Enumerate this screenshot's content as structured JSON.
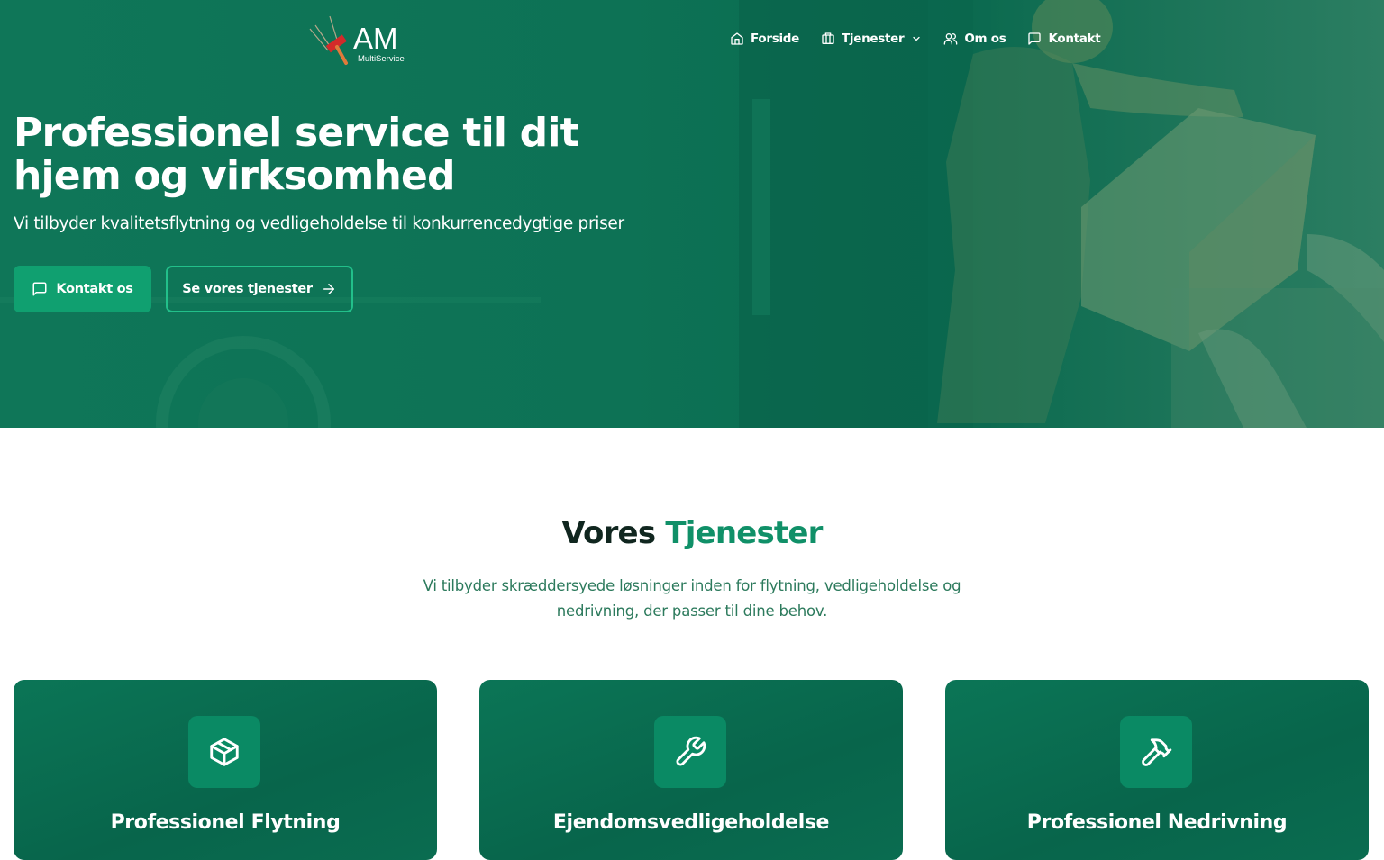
{
  "brand": {
    "logo_text": "AM",
    "logo_subtext": "MultiService"
  },
  "nav": {
    "items": [
      {
        "label": "Forside",
        "icon": "home-icon"
      },
      {
        "label": "Tjenester",
        "icon": "building-icon",
        "dropdown": true
      },
      {
        "label": "Om os",
        "icon": "users-icon"
      },
      {
        "label": "Kontakt",
        "icon": "message-square-icon"
      }
    ]
  },
  "hero": {
    "title": "Professionel service til dit hjem og virksomhed",
    "subtitle": "Vi tilbyder kvalitetsflytning og vedligeholdelse til konkurrencedygtige priser",
    "primary_button": "Kontakt os",
    "secondary_button": "Se vores tjenester"
  },
  "services": {
    "title_part1": "Vores",
    "title_part2": "Tjenester",
    "description": "Vi tilbyder skræddersyede løsninger inden for flytning, vedligeholdelse og nedrivning, der passer til dine behov.",
    "cards": [
      {
        "title": "Professionel Flytning",
        "icon": "package-icon"
      },
      {
        "title": "Ejendomsvedligeholdelse",
        "icon": "wrench-icon"
      },
      {
        "title": "Professionel Nedrivning",
        "icon": "hammer-icon"
      }
    ]
  },
  "colors": {
    "hero_green": "#0d7255",
    "accent": "#109068",
    "button_primary": "#10a070",
    "card_green": "#08654b",
    "heading_dark": "#10261f"
  }
}
